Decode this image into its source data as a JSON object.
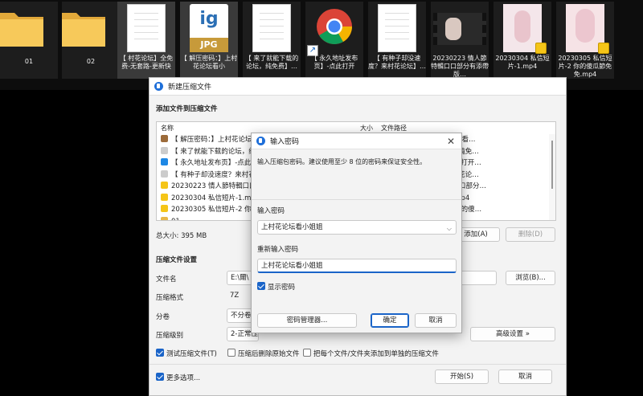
{
  "desktop": {
    "files": [
      {
        "name": "01",
        "kind": "folder"
      },
      {
        "name": "02",
        "kind": "folder"
      },
      {
        "name": "【 村花论坛】全免费-无套路-更新快",
        "kind": "document"
      },
      {
        "name": "【 解压密码：】上村花论坛看小",
        "kind": "jpg",
        "label": "JPG"
      },
      {
        "name": "【 来了就能下载的论坛，纯免费】…",
        "kind": "document"
      },
      {
        "name": "【 永久地址发布页】-点此打开",
        "kind": "chrome"
      },
      {
        "name": "【 有种子却没速度？来村花论坛】…",
        "kind": "document"
      },
      {
        "name": "20230223 情人節特輯口口部分有添帶版…",
        "kind": "video"
      },
      {
        "name": "20230304 私信短片-1.mp4",
        "kind": "video"
      },
      {
        "name": "20230305 私信短片-2 你的傻瓜節免免.mp4",
        "kind": "video"
      }
    ]
  },
  "main_dialog": {
    "title": "新建压缩文件",
    "section_add": "添加文件到压缩文件",
    "list": {
      "col_name": "名称",
      "col_size": "大小",
      "col_path": "文件路径",
      "rows": [
        {
          "name": "【 解压密码：】上村花论坛看小姐姐",
          "path": "【 解压密码：】上村花论坛看…",
          "icon_color": "#9c6b3a"
        },
        {
          "name": "【 来了就能下载的论坛，纯免费】",
          "path": "【 来了就能下载的论坛，纯免…",
          "icon_color": "#cccccc"
        },
        {
          "name": "【 永久地址发布页】-点此打开",
          "path": "【 永久地址发布页】-点此打开…",
          "icon_color": "#1e88e5"
        },
        {
          "name": "【 有种子却没速度？来村花论坛",
          "path": "【 有种子却没速度？来村花论…",
          "icon_color": "#cccccc"
        },
        {
          "name": "20230223 情人節特輯口口部分",
          "path": "20230223 情人節特輯口口部分…",
          "icon_color": "#f5c518"
        },
        {
          "name": "20230304 私信短片-1.mp4",
          "path": "20230304 私信短片-1.mp4",
          "icon_color": "#f5c518"
        },
        {
          "name": "20230305 私信短片-2 你的傻瓜",
          "path": "20230305 私信短片-2 你的傻…",
          "icon_color": "#f5c518"
        },
        {
          "name": "01",
          "path": "",
          "icon_color": "#e8b84a"
        }
      ]
    },
    "total_size": "总大小: 395 MB",
    "add_button": "添加(A)",
    "delete_button": "删除(D)",
    "settings_title": "压缩文件设置",
    "filename_label": "文件名",
    "filename_value": "E:\\爾\\",
    "browse_button": "浏览(B)...",
    "format_label": "压缩格式",
    "format_value": "7Z",
    "split_label": "分卷",
    "split_value": "不分卷",
    "level_label": "压缩级别",
    "level_value": "2-正常压缩",
    "advanced_button": "高级设置 »",
    "check_test": "测试压缩文件(T)",
    "check_delete": "压缩后删除原始文件",
    "check_separate": "把每个文件/文件夹添加到单独的压缩文件",
    "more_options": "更多选项...",
    "start_button": "开始(S)",
    "cancel_button": "取消"
  },
  "password_dialog": {
    "title": "输入密码",
    "description": "输入压缩包密码。建议使用至少 8 位的密码来保证安全性。",
    "password_label": "输入密码",
    "password_value": "上村花论坛看小姐姐",
    "confirm_label": "重新输入密码",
    "confirm_value": "上村花论坛看小姐姐",
    "show_password": "显示密码",
    "manager_button": "密码管理器...",
    "ok_button": "确定",
    "cancel_button": "取消"
  }
}
